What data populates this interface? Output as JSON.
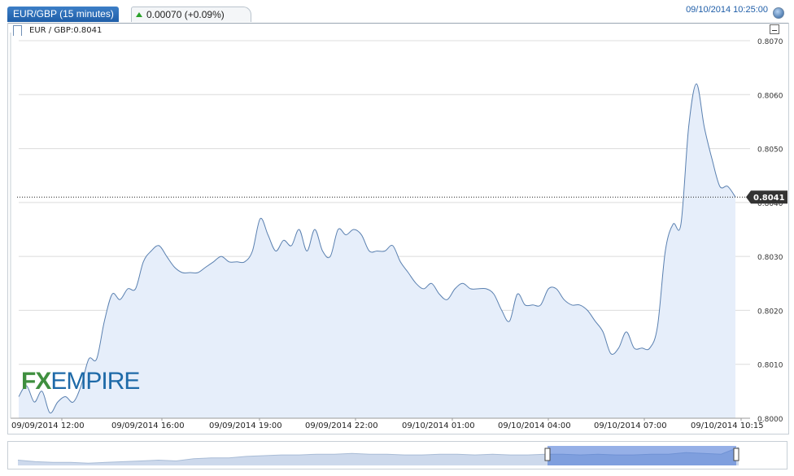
{
  "header": {
    "instrument_tab": "EUR/GBP (15 minutes)",
    "change_text": "0.00070 (+0.09%)",
    "timestamp": "09/10/2014 10:25:00"
  },
  "legend": {
    "label": "EUR / GBP:0.8041"
  },
  "logo": {
    "fx": "FX",
    "empire": "EMPIRE"
  },
  "colors": {
    "series_line": "#5a80b0",
    "area_fill": "#e6eefa",
    "accent": "#1f5ea8",
    "up": "#2aa12a"
  },
  "chart_data": {
    "type": "area",
    "title": "EUR / GBP",
    "ylim": [
      0.8,
      0.807
    ],
    "y_ticks": [
      "0.8070",
      "0.8060",
      "0.8050",
      "0.8040",
      "0.8030",
      "0.8020",
      "0.8010",
      "0.8000"
    ],
    "current_value": 0.8041,
    "current_label": "0.8041",
    "x_tick_labels": [
      "09/09/2014 12:00",
      "09/09/2014 16:00",
      "09/09/2014 19:00",
      "09/09/2014 22:00",
      "09/10/2014 01:00",
      "09/10/2014 04:00",
      "09/10/2014 07:00",
      "09/10/2014 10:15"
    ],
    "grid": true,
    "series": [
      {
        "x_start": "09/09/2014 11:45",
        "interval_minutes": 15,
        "values": [
          0.8004,
          0.8006,
          0.8003,
          0.8005,
          0.8001,
          0.8003,
          0.8004,
          0.8003,
          0.8006,
          0.8011,
          0.8011,
          0.8018,
          0.8023,
          0.8022,
          0.8024,
          0.8024,
          0.8029,
          0.8031,
          0.8032,
          0.803,
          0.8028,
          0.8027,
          0.8027,
          0.8027,
          0.8028,
          0.8029,
          0.803,
          0.8029,
          0.8029,
          0.8029,
          0.8031,
          0.8037,
          0.8034,
          0.8031,
          0.8033,
          0.8032,
          0.8035,
          0.8031,
          0.8035,
          0.8031,
          0.803,
          0.8035,
          0.8034,
          0.8035,
          0.8034,
          0.8031,
          0.8031,
          0.8031,
          0.8032,
          0.8029,
          0.8027,
          0.8025,
          0.8024,
          0.8025,
          0.8023,
          0.8022,
          0.8024,
          0.8025,
          0.8024,
          0.8024,
          0.8024,
          0.8023,
          0.802,
          0.8018,
          0.8023,
          0.8021,
          0.8021,
          0.8021,
          0.8024,
          0.8024,
          0.8022,
          0.8021,
          0.8021,
          0.802,
          0.8018,
          0.8016,
          0.8012,
          0.8013,
          0.8016,
          0.8013,
          0.8013,
          0.8013,
          0.8017,
          0.8031,
          0.8036,
          0.8036,
          0.8054,
          0.8062,
          0.8054,
          0.8048,
          0.8043,
          0.8043,
          0.8041
        ]
      }
    ]
  },
  "navigator_data": {
    "values": [
      0.8005,
      0.8003,
      0.8002,
      0.8002,
      0.8001,
      0.8002,
      0.8003,
      0.8004,
      0.8005,
      0.8004,
      0.8007,
      0.8008,
      0.8008,
      0.801,
      0.8011,
      0.8012,
      0.8012,
      0.8013,
      0.8013,
      0.8014,
      0.8013,
      0.8013,
      0.8012,
      0.8012,
      0.8013,
      0.8013,
      0.8012,
      0.8013,
      0.8012,
      0.8012,
      0.8013,
      0.8013,
      0.8012,
      0.8013,
      0.8012,
      0.8012,
      0.8013,
      0.8013,
      0.8015,
      0.8014,
      0.8013,
      0.8022
    ]
  }
}
